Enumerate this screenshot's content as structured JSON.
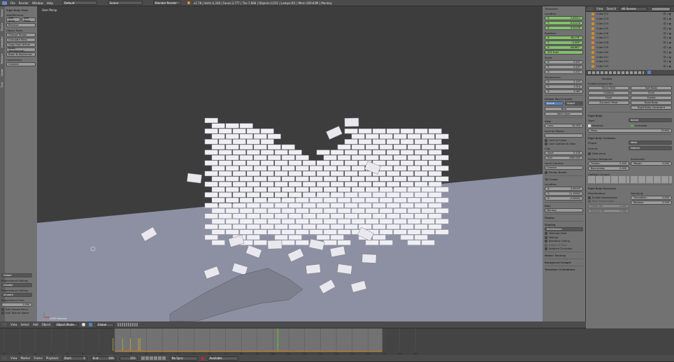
{
  "top": {
    "menus": [
      "File",
      "Render",
      "Window",
      "Help"
    ],
    "layout": "Default",
    "scene": "Scene",
    "engine": "Blender Render",
    "stats": "v2.78 | Verts:4,336 | Faces:3,777 | Tris:7,668 | Objects:1/231 | Lamps:0/1 | Mem:169.83M | Monkey"
  },
  "toolshelf": {
    "tabs": [
      "Tools",
      "Create",
      "Relations",
      "Animation",
      "Physics",
      "Grease"
    ],
    "title": "Rigid Body Tools",
    "add_remove": "Add/Remove:",
    "add_active": "Add Activ",
    "add_passive": "Add Passi",
    "remove": "Remove",
    "object_tools": "Object Tools:",
    "buttons": [
      "Change Shape",
      "Calculate Mass",
      "Copy from Active",
      "Apply Transformati..",
      "Bake To Keyframes"
    ],
    "constraints": "Constraints:",
    "connect": "Connect",
    "orientation": "Global",
    "prop_edit_label": "Proportional Editing:",
    "prop_edit": "Disable",
    "prop_falloff_label": "Proportional Editing:",
    "prop_falloff": "Smooth",
    "prop_size_label": "Proportional Size:",
    "prop_size": "1.000",
    "edit_gp": "Edit Grease Pencil",
    "edit_tex": "Edit Texture Space"
  },
  "viewport": {
    "label": "User Persp",
    "object_label": "(103) Monkey"
  },
  "npanel": {
    "transform": "Transform",
    "location": "Location:",
    "loc": [
      [
        "X:",
        "2.63211"
      ],
      [
        "Y:",
        "-0.51118"
      ],
      [
        "Z:",
        "6.54198"
      ]
    ],
    "rotation": "Rotation:",
    "rot": [
      [
        "X:",
        "86.278°"
      ],
      [
        "Y:",
        "-0.043°"
      ],
      [
        "Z:",
        "-68.667°"
      ]
    ],
    "rot_mode": "XYZ Euler",
    "scale": "Scale:",
    "scl": [
      [
        "X:",
        "0.437"
      ],
      [
        "Y:",
        "0.437"
      ],
      [
        "Z:",
        "0.437"
      ]
    ],
    "dimensions": "Dimensions:",
    "dim": [
      [
        "X:",
        "2.193"
      ],
      [
        "Y:",
        "1.010"
      ],
      [
        "Z:",
        "3.087"
      ]
    ],
    "gp": "Grease Pencil Layers",
    "scene_btn": "Scene",
    "object_btn": "Object",
    "new": "New",
    "new_layer": "New Layer",
    "view": "View",
    "lens": "Lens:",
    "lens_val": "35.000",
    "lock_obj": "Lock to Object:",
    "lock_cursor": "Lock to Cursor",
    "lock_cam": "Lock Camera to View",
    "clip": "Clip:",
    "start": "Start:",
    "start_val": "0.100",
    "end": "End:",
    "end_val": "1000.000",
    "local_cam": "Local Camera:",
    "camera": "Camera",
    "render_border": "Render Border",
    "cursor": "3D Cursor",
    "cursor_loc": "Location:",
    "cur": [
      [
        "X:",
        "-3.66205"
      ],
      [
        "Y:",
        "11.19942"
      ],
      [
        "Z:",
        "-0.05001"
      ]
    ],
    "item": "Item",
    "item_name": "Monkey",
    "display": "Display",
    "shading": "Shading",
    "shade_mode": "Multitexture",
    "textured_solid": "Textured Solid",
    "matcap": "Matcap",
    "backface": "Backface Culling",
    "dof": "Depth Of Field",
    "ao": "Ambient Occlusion",
    "motion_tracking": "Motion Tracking",
    "bg_images": "Background Images",
    "transform_orient": "Transform Orientations"
  },
  "outliner": {
    "view": "View",
    "search": "Search",
    "filter": "All Scenes",
    "items": [
      "Cube.212",
      "Cube.213",
      "Cube.214",
      "Cube.215",
      "Cube.216",
      "Cube.217",
      "Cube.218",
      "Cube.219",
      "Cube.220",
      "Cube.221",
      "Cube.222",
      "Cube.223"
    ]
  },
  "properties": {
    "object": "Monkey",
    "enable": "Enable physics for:",
    "physics_left": [
      "Force Field",
      "Collision",
      "Cloth",
      "Dynamic Paint"
    ],
    "physics_right": [
      "Soft Body",
      "Fluid",
      "Smoke",
      "Rigid Body",
      "Rigid Body Constraint"
    ],
    "rigid_body": "Rigid Body",
    "type_label": "Type:",
    "type": "Active",
    "dynamic": "Dynamic",
    "animated": "Animated",
    "mass_label": "Mass:",
    "mass": "13.600",
    "collisions": "Rigid Body Collisions",
    "shape_label": "Shape:",
    "shape": "Mesh",
    "source_label": "Source:",
    "source": "Deform",
    "deforming": "Deforming",
    "surface": "Surface Response:",
    "friction": "Friction:",
    "friction_val": "0.500",
    "bounciness": "Bounciness:",
    "bounciness_val": "0.000",
    "sensitivity": "Sensitivity:",
    "margin": "Margin:",
    "margin_val": "0.040",
    "groups": "Collision Groups:",
    "dynamics": "Rigid Body Dynamics",
    "deactivation": "Deactivation:",
    "enable_deact": "Enable Deactivation",
    "start_deact": "Start Deactivated",
    "linear": "Linear Vel:",
    "linear_val": "0.400",
    "angular": "Angular Vel:",
    "angular_val": "0.500",
    "damping": "Damping:",
    "translation": "Translation:",
    "translation_val": "0.040",
    "rot_damp": "Rotation:",
    "rot_damp_val": "0.100"
  },
  "view3d_header": {
    "menus": [
      "View",
      "Select",
      "Add",
      "Object"
    ],
    "mode": "Object Mode",
    "orientation": "Global"
  },
  "timeline": {
    "ticks": [
      -70,
      -60,
      -50,
      -40,
      -30,
      -20,
      -10,
      0,
      10,
      20,
      30,
      40,
      50,
      60,
      70,
      80,
      90,
      100,
      110,
      120,
      130,
      140,
      150,
      160,
      170,
      180,
      190
    ],
    "current_frame": 103,
    "keyframes": [
      -1,
      5,
      10,
      15,
      16
    ],
    "menus": [
      "View",
      "Marker",
      "Frame",
      "Playback"
    ],
    "start_label": "Start:",
    "start": "1",
    "end_label": "End:",
    "end": "169",
    "frame": "103",
    "sync": "No Sync",
    "keying": "Available",
    "colors": {
      "range": "#727272",
      "outside": "#444444",
      "current": "#60c040",
      "bar": "#c08030"
    }
  }
}
